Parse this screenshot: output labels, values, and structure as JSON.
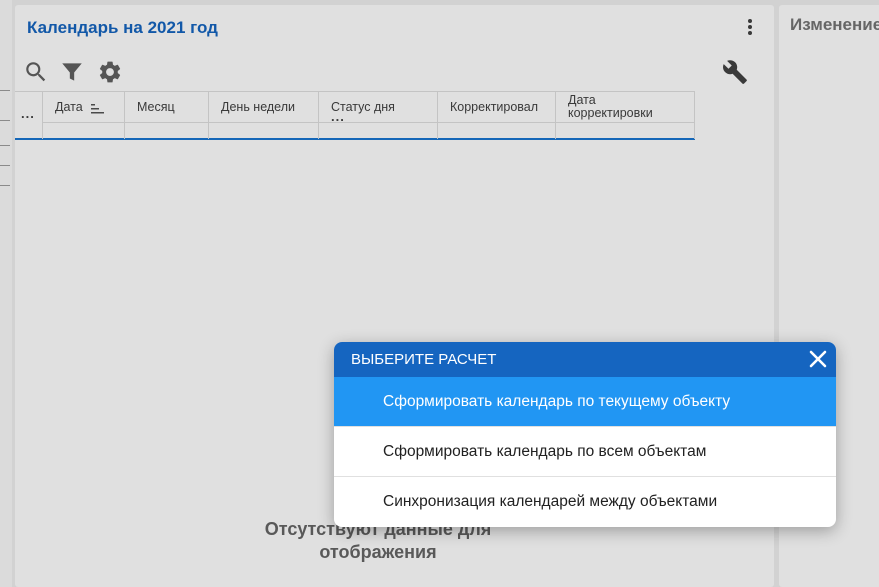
{
  "main_panel": {
    "title": "Календарь на 2021 год"
  },
  "toolbar": {
    "icons": [
      "search-icon",
      "filter-icon",
      "gear-icon",
      "wrench-icon"
    ]
  },
  "grid": {
    "columns": [
      {
        "label": "Дата"
      },
      {
        "label": "Месяц"
      },
      {
        "label": "День недели"
      },
      {
        "label": "Статус дня"
      },
      {
        "label": "Корректировал"
      },
      {
        "label_line1": "Дата",
        "label_line2": "корректировки"
      }
    ],
    "row_menu_dots": "...",
    "status_filter_dots": "..."
  },
  "empty_message": {
    "line1": "Отсутствуют данные для",
    "line2": "отображения"
  },
  "right_panel": {
    "title": "Изменение"
  },
  "dialog": {
    "title": "ВЫБЕРИТЕ РАСЧЕТ",
    "options": [
      {
        "label": "Сформировать календарь по текущему объекту",
        "selected": true
      },
      {
        "label": "Сформировать календарь по всем объектам",
        "selected": false
      },
      {
        "label": "Синхронизация календарей между объектами",
        "selected": false
      }
    ]
  },
  "colors": {
    "accent": "#1565c0",
    "selected": "#2196f3"
  }
}
